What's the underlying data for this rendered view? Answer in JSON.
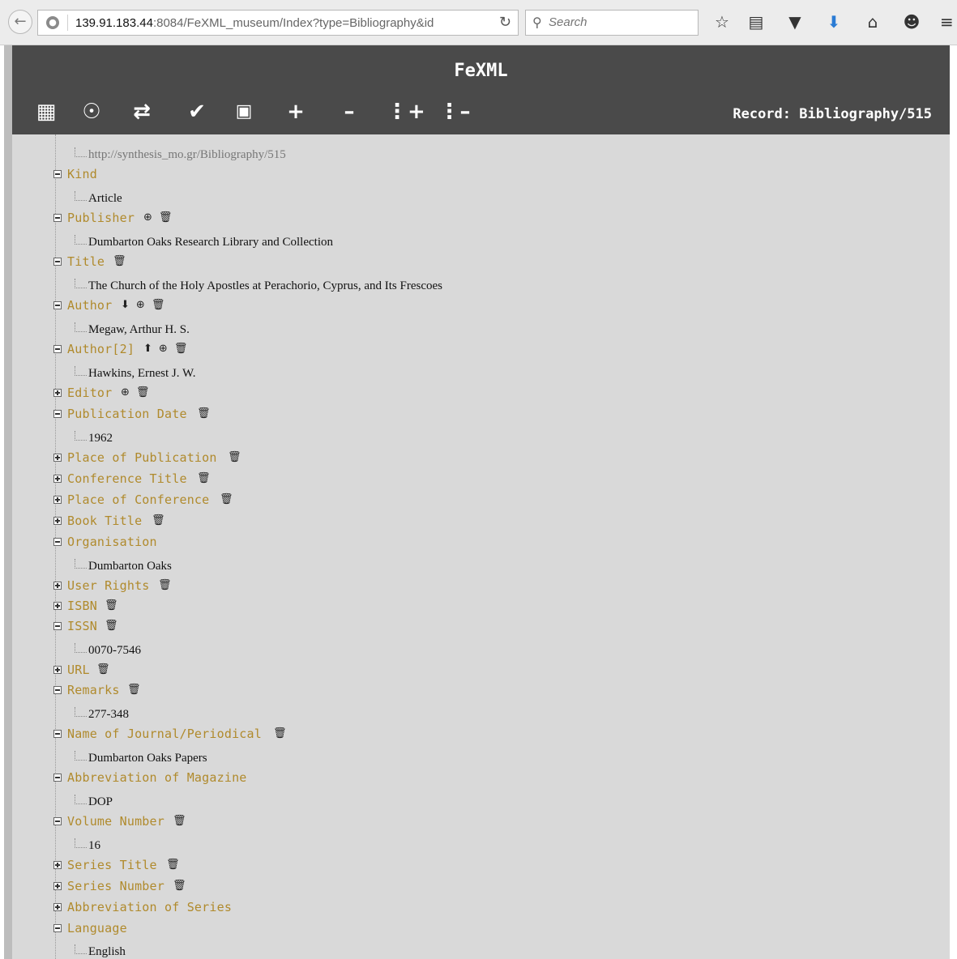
{
  "browser": {
    "url_host": "139.91.183.44",
    "url_rest": ":8084/FeXML_museum/Index?type=Bibliography&id",
    "search_placeholder": "Search"
  },
  "app": {
    "title": "FeXML",
    "record_label": "Record: Bibliography/515"
  },
  "tree": {
    "uri": "http://synthesis_mo.gr/Bibliography/515",
    "kind": {
      "label": "Kind",
      "value": "Article"
    },
    "publisher": {
      "label": "Publisher",
      "value": "Dumbarton Oaks Research Library and Collection"
    },
    "title": {
      "label": "Title",
      "value": "The Church of the Holy Apostles at Perachorio, Cyprus, and Its Frescoes"
    },
    "author": {
      "label": "Author",
      "value": "Megaw, Arthur H. S."
    },
    "author2": {
      "label": "Author[2]",
      "value": "Hawkins, Ernest J. W."
    },
    "editor": {
      "label": "Editor"
    },
    "publication_date": {
      "label": "Publication Date",
      "value": "1962"
    },
    "place_of_publication": {
      "label": "Place of Publication"
    },
    "conference_title": {
      "label": "Conference Title"
    },
    "place_of_conference": {
      "label": "Place of Conference"
    },
    "book_title": {
      "label": "Book Title"
    },
    "organisation": {
      "label": "Organisation",
      "value": "Dumbarton Oaks"
    },
    "user_rights": {
      "label": "User Rights"
    },
    "isbn": {
      "label": "ISBN"
    },
    "issn": {
      "label": "ISSN",
      "value": "0070-7546"
    },
    "url": {
      "label": "URL"
    },
    "remarks": {
      "label": "Remarks",
      "value": "277-348"
    },
    "journal": {
      "label": "Name of Journal/Periodical",
      "value": "Dumbarton Oaks Papers"
    },
    "abbrev_magazine": {
      "label": "Abbreviation of Magazine",
      "value": "DOP"
    },
    "volume_number": {
      "label": "Volume Number",
      "value": "16"
    },
    "series_title": {
      "label": "Series Title"
    },
    "series_number": {
      "label": "Series Number"
    },
    "abbrev_series": {
      "label": "Abbreviation of Series"
    },
    "language": {
      "label": "Language",
      "value": "English"
    }
  }
}
